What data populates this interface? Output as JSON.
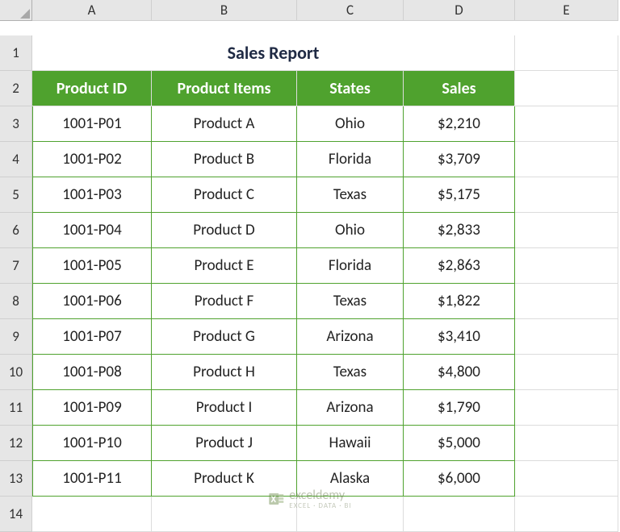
{
  "columns": [
    "A",
    "B",
    "C",
    "D",
    "E"
  ],
  "rowNumbers": [
    "1",
    "2",
    "3",
    "4",
    "5",
    "6",
    "7",
    "8",
    "9",
    "10",
    "11",
    "12",
    "13",
    "14"
  ],
  "title": "Sales Report",
  "headers": {
    "productId": "Product ID",
    "productItems": "Product Items",
    "states": "States",
    "sales": "Sales"
  },
  "rows": [
    {
      "id": "1001-P01",
      "item": "Product A",
      "state": "Ohio",
      "sales": "$2,210"
    },
    {
      "id": "1001-P02",
      "item": "Product B",
      "state": "Florida",
      "sales": "$3,709"
    },
    {
      "id": "1001-P03",
      "item": "Product C",
      "state": "Texas",
      "sales": "$5,175"
    },
    {
      "id": "1001-P04",
      "item": "Product D",
      "state": "Ohio",
      "sales": "$2,833"
    },
    {
      "id": "1001-P05",
      "item": "Product E",
      "state": "Florida",
      "sales": "$2,863"
    },
    {
      "id": "1001-P06",
      "item": "Product F",
      "state": "Texas",
      "sales": "$1,822"
    },
    {
      "id": "1001-P07",
      "item": "Product G",
      "state": "Arizona",
      "sales": "$3,410"
    },
    {
      "id": "1001-P08",
      "item": "Product H",
      "state": "Texas",
      "sales": "$4,800"
    },
    {
      "id": "1001-P09",
      "item": "Product I",
      "state": "Arizona",
      "sales": "$1,790"
    },
    {
      "id": "1001-P10",
      "item": "Product J",
      "state": "Hawaii",
      "sales": "$5,000"
    },
    {
      "id": "1001-P11",
      "item": "Product K",
      "state": "Alaska",
      "sales": "$6,000"
    }
  ],
  "watermark": {
    "brand": "exceldemy",
    "sub": "EXCEL · DATA · BI"
  }
}
